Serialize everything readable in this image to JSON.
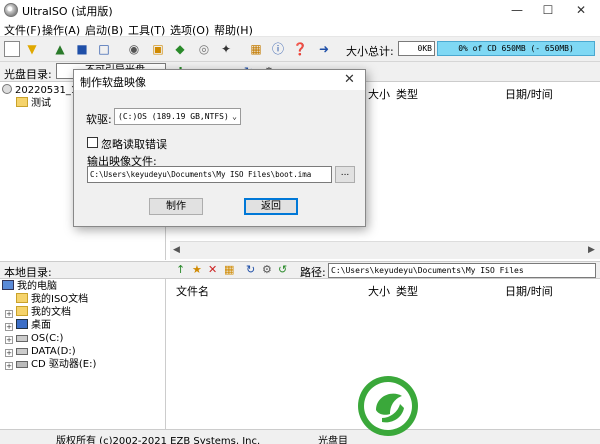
{
  "window": {
    "title": "UltraISO (试用版)",
    "minimize_icon": "minimize-icon",
    "maximize_icon": "maximize-icon",
    "close_icon": "close-icon"
  },
  "menu": [
    "文件(F)",
    "操作(A)",
    "启动(B)",
    "工具(T)",
    "选项(O)",
    "帮助(H)"
  ],
  "toolbar": {
    "size_label": "大小总计:",
    "size_value": "0KB",
    "capacity_text": "0% of CD 650MB (- 650MB)"
  },
  "upper_pane": {
    "disc_dir_label": "光盘目录:",
    "disc_dir_value": "不可引导光盘",
    "path_label": "路径",
    "tree": [
      {
        "label": "20220531_110"
      },
      {
        "label": "测试"
      }
    ],
    "columns": {
      "size": "大小",
      "type": "类型",
      "datetime": "日期/时间"
    }
  },
  "lower_pane": {
    "local_dir_label": "本地目录:",
    "path_label": "路径:",
    "path_value": "C:\\Users\\keyudeyu\\Documents\\My ISO Files",
    "tree": [
      {
        "label": "我的电脑"
      },
      {
        "label": "我的ISO文档"
      },
      {
        "label": "我的文档"
      },
      {
        "label": "桌面"
      },
      {
        "label": "OS(C:)"
      },
      {
        "label": "DATA(D:)"
      },
      {
        "label": "CD 驱动器(E:)"
      }
    ],
    "columns": {
      "name": "文件名",
      "size": "大小",
      "type": "类型",
      "datetime": "日期/时间"
    }
  },
  "dialog": {
    "title": "制作软盘映像",
    "drive_label": "软驱:",
    "drive_value": "(C:)OS (189.19 GB,NTFS)",
    "ignore_label": "忽略读取错误",
    "output_label": "输出映像文件:",
    "output_value": "C:\\Users\\keyudeyu\\Documents\\My ISO Files\\boot.ima",
    "browse_label": "...",
    "make_button": "制作",
    "return_button": "返回"
  },
  "status": {
    "copyright": "版权所有 (c)2002-2021 EZB Systems, Inc.",
    "right": "光盘目"
  },
  "colors": {
    "capacity_bar": "#7fd8f4",
    "logo_green": "#3aa83a"
  }
}
